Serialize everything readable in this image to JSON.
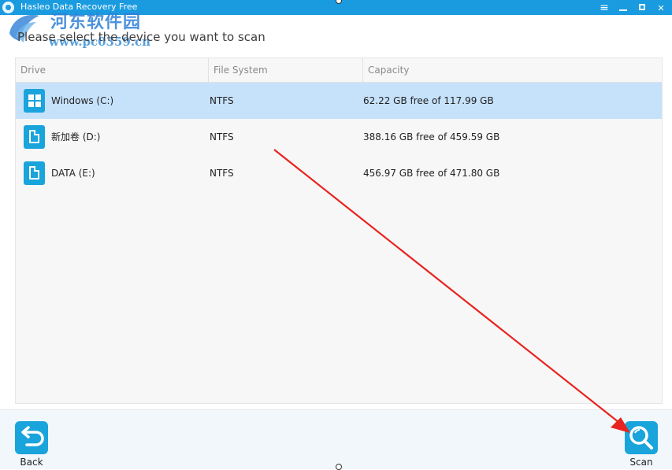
{
  "window": {
    "title": "Hasleo Data Recovery Free",
    "accent": "#1a9be0"
  },
  "watermark": {
    "cn_text": "河东软件园",
    "url": "www.pc0359.cn"
  },
  "instruction": "Please select the device you want to scan",
  "table": {
    "headers": [
      "Drive",
      "File System",
      "Capacity"
    ],
    "rows": [
      {
        "name": "Windows (C:)",
        "fs": "NTFS",
        "capacity": "62.22 GB free of 117.99 GB",
        "icon": "windows-drive-icon",
        "selected": true
      },
      {
        "name": "新加卷 (D:)",
        "fs": "NTFS",
        "capacity": "388.16 GB free of 459.59 GB",
        "icon": "drive-icon",
        "selected": false
      },
      {
        "name": "DATA (E:)",
        "fs": "NTFS",
        "capacity": "456.97 GB free of 471.80 GB",
        "icon": "drive-icon",
        "selected": false
      }
    ]
  },
  "actions": {
    "back_label": "Back",
    "scan_label": "Scan"
  },
  "colors": {
    "selected_row": "#c6e2fb",
    "icon_blue": "#1aa4dc",
    "annotation_arrow": "#e8231f"
  }
}
